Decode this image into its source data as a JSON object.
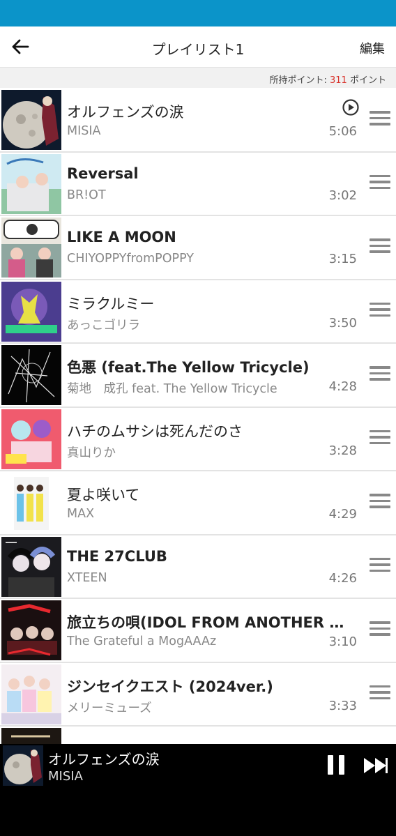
{
  "header": {
    "back_icon": "arrow-left-icon",
    "title": "プレイリスト1",
    "edit_label": "編集"
  },
  "points": {
    "label": "所持ポイント:",
    "value": "311",
    "unit": "ポイント",
    "value_color": "#d8322b"
  },
  "colors": {
    "status_bar": "#0b94c9",
    "mini_player_bg": "#000000"
  },
  "tracks": [
    {
      "title": "オルフェンズの涙",
      "artist": "MISIA",
      "duration": "5:06",
      "now_playing": true
    },
    {
      "title": "Reversal",
      "artist": "BR!OT",
      "duration": "3:02"
    },
    {
      "title": "LIKE A MOON",
      "artist": "CHIYOPPYfromPOPPY",
      "duration": "3:15"
    },
    {
      "title": "ミラクルミー",
      "artist": "あっこゴリラ",
      "duration": "3:50"
    },
    {
      "title": "色悪 (feat.The Yellow Tricycle)",
      "artist": "菊地　成孔 feat. The Yellow Tricycle",
      "duration": "4:28"
    },
    {
      "title": "ハチのムサシは死んだのさ",
      "artist": "真山りか",
      "duration": "3:28"
    },
    {
      "title": "夏よ咲いて",
      "artist": "MAX",
      "duration": "4:29"
    },
    {
      "title": "THE 27CLUB",
      "artist": "XTEEN",
      "duration": "4:26"
    },
    {
      "title": "旅立ちの唄(IDOL FROM ANOTHER P...",
      "artist": "The Grateful a MogAAAz",
      "duration": "3:10"
    },
    {
      "title": "ジンセイクエスト (2024ver.)",
      "artist": "メリーミューズ",
      "duration": "3:33"
    },
    {
      "title": "",
      "artist": "",
      "duration": ""
    }
  ],
  "now_playing": {
    "title": "オルフェンズの涙",
    "artist": "MISIA",
    "pause_icon": "pause-icon",
    "next_icon": "skip-next-icon"
  }
}
